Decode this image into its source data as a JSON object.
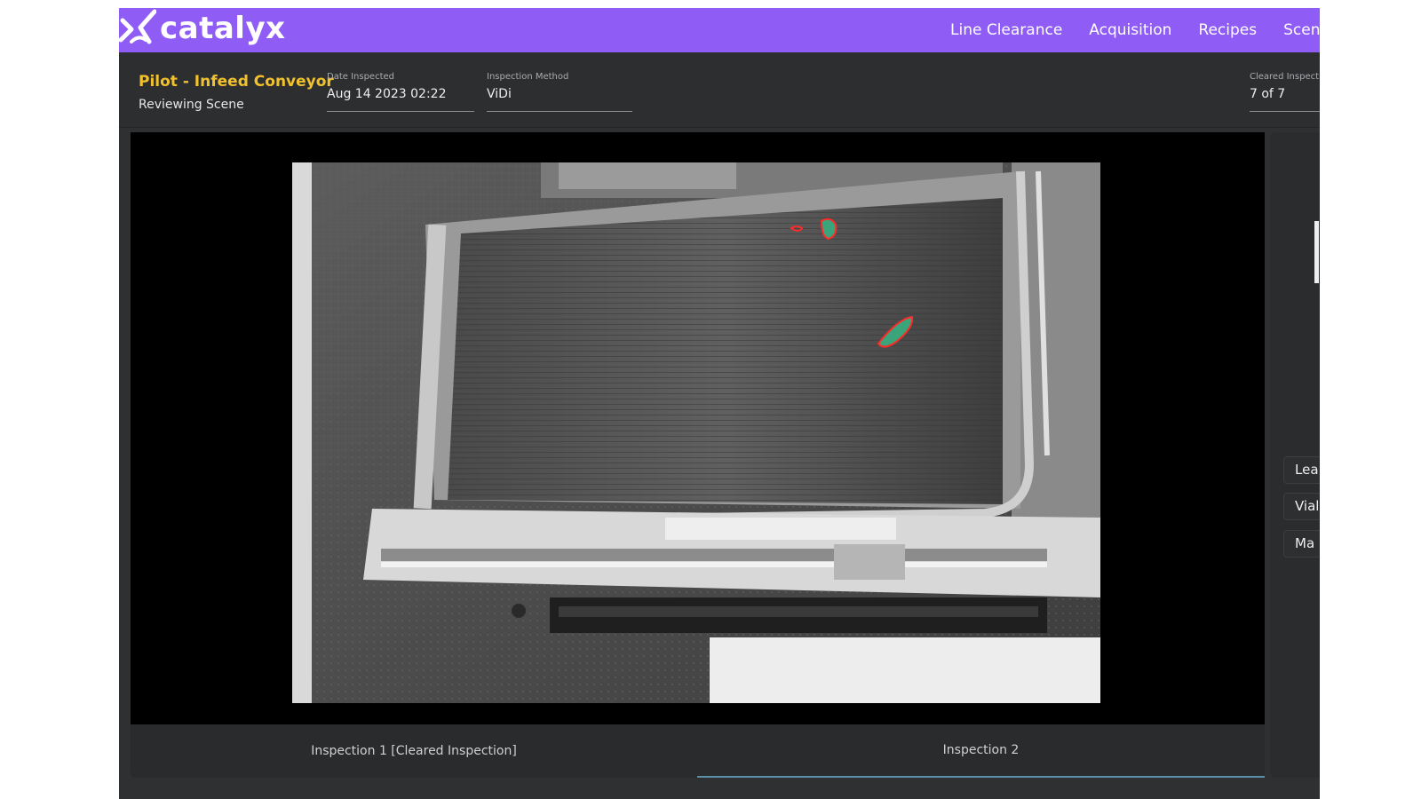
{
  "app": {
    "brand": "catalyx",
    "accent_color": "#8f5cf5",
    "logo_icon": "catalyx-logo-mark"
  },
  "nav": {
    "items": [
      {
        "label": "Line Clearance"
      },
      {
        "label": "Acquisition"
      },
      {
        "label": "Recipes"
      },
      {
        "label": "Scenes"
      }
    ]
  },
  "header": {
    "scene_title": "Pilot - Infeed Conveyor",
    "scene_title_color": "#f2c12e",
    "scene_subtitle": "Reviewing Scene",
    "date_label": "Date Inspected",
    "date_value": "Aug 14 2023 02:22",
    "method_label": "Inspection Method",
    "method_value": "ViDi",
    "cleared_label": "Cleared Inspecti",
    "cleared_value": "7 of 7"
  },
  "viewer": {
    "image_description_icon": "conveyor-camera-image",
    "detections": 3,
    "detection_outline_color": "#ff2a2a",
    "detection_fill_color": "#3aa57a"
  },
  "tabs": [
    {
      "label": "Inspection 1 [Cleared Inspection]",
      "active": false
    },
    {
      "label": "Inspection 2",
      "active": true
    }
  ],
  "right_panel": {
    "buttons": [
      {
        "label": "Lea"
      },
      {
        "label": "Vial"
      },
      {
        "label": "Ma"
      }
    ]
  }
}
